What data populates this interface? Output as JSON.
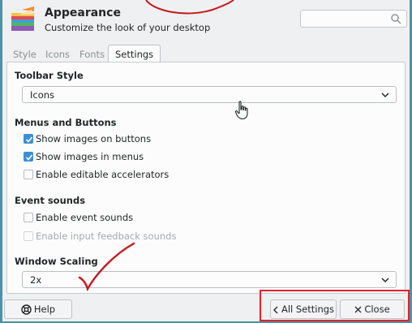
{
  "header": {
    "title": "Appearance",
    "subtitle": "Customize the look of your desktop",
    "search_placeholder": ""
  },
  "tabs": [
    {
      "label": "Style",
      "active": false
    },
    {
      "label": "Icons",
      "active": false
    },
    {
      "label": "Fonts",
      "active": false
    },
    {
      "label": "Settings",
      "active": true
    }
  ],
  "toolbar_style": {
    "heading": "Toolbar Style",
    "value": "Icons"
  },
  "menus_buttons": {
    "heading": "Menus and Buttons",
    "options": [
      {
        "label": "Show images on buttons",
        "checked": true,
        "enabled": true
      },
      {
        "label": "Show images in menus",
        "checked": true,
        "enabled": true
      },
      {
        "label": "Enable editable accelerators",
        "checked": false,
        "enabled": true
      }
    ]
  },
  "event_sounds": {
    "heading": "Event sounds",
    "options": [
      {
        "label": "Enable event sounds",
        "checked": false,
        "enabled": true
      },
      {
        "label": "Enable input feedback sounds",
        "checked": false,
        "enabled": false
      }
    ]
  },
  "window_scaling": {
    "heading": "Window Scaling",
    "value": "2x"
  },
  "footer": {
    "help_label": "Help",
    "all_settings_label": "All Settings",
    "close_label": "Close"
  },
  "colors": {
    "accent": "#3d8fd1",
    "annotation_red": "#e3222a",
    "window_border": "#4a93a8"
  }
}
